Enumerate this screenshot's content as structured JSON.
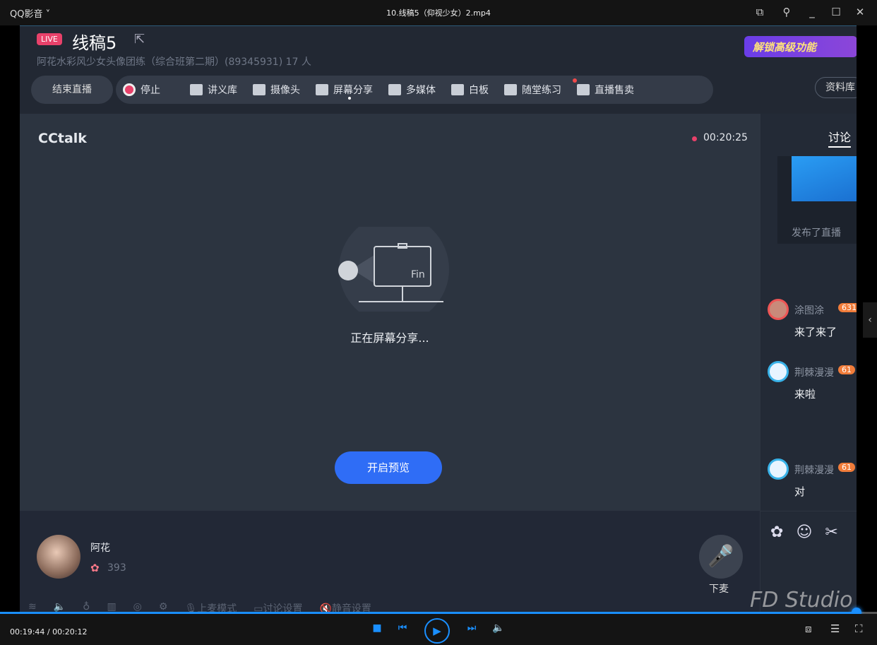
{
  "player": {
    "app_name": "QQ影音 ˅",
    "file_name": "10.线稿5（仰视少女）2.mp4",
    "time": "00:19:44 / 00:20:12",
    "progress": 0.977,
    "accent": "#1a8fff",
    "watermark": "FD Studio"
  },
  "header": {
    "live_badge": "LIVE",
    "title": "线稿5",
    "subtitle": "阿花水彩风少女头像团练（综合班第二期）(89345931)    17 人",
    "promo": "解锁高级功能",
    "end_live": "结束直播",
    "materials": "资料库",
    "tools": [
      {
        "label": "停止",
        "icon": "record-icon"
      },
      {
        "label": "讲义库",
        "icon": "slides-icon"
      },
      {
        "label": "摄像头",
        "icon": "camera-icon"
      },
      {
        "label": "屏幕分享",
        "icon": "screen-share-icon"
      },
      {
        "label": "多媒体",
        "icon": "media-icon"
      },
      {
        "label": "白板",
        "icon": "whiteboard-icon"
      },
      {
        "label": "随堂练习",
        "icon": "exercise-icon"
      },
      {
        "label": "直播售卖",
        "icon": "shop-icon"
      }
    ]
  },
  "stage": {
    "logo": "CCtalk",
    "timer": "00:20:25",
    "illustration_text": "Fin",
    "status": "正在屏幕分享...",
    "preview_button": "开启预览"
  },
  "host": {
    "name": "阿花",
    "flowers": "393",
    "mic_label": "下麦"
  },
  "bottom_tools": [
    "上麦模式",
    "讨论设置",
    "静音设置"
  ],
  "chat": {
    "tab": "讨论",
    "card_text": "发布了直播",
    "messages": [
      {
        "user": "涂图涂",
        "level": "631",
        "text": "来了来了"
      },
      {
        "user": "荆棘漫漫",
        "level": "61",
        "text": "来啦"
      },
      {
        "user": "荆棘漫漫",
        "level": "61",
        "text": "对"
      }
    ]
  }
}
